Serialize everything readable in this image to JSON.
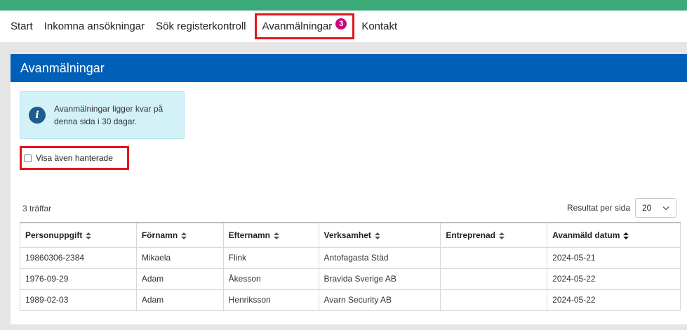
{
  "nav": {
    "items": [
      {
        "label": "Start"
      },
      {
        "label": "Inkomna ansökningar"
      },
      {
        "label": "Sök registerkontroll"
      },
      {
        "label": "Avanmälningar",
        "badge": "3"
      },
      {
        "label": "Kontakt"
      }
    ]
  },
  "panel": {
    "title": "Avanmälningar",
    "info_text": "Avanmälningar ligger kvar på denna sida i 30 dagar.",
    "checkbox_label": "Visa även hanterade",
    "hits": "3 träffar",
    "per_page_label": "Resultat per sida",
    "per_page_value": "20"
  },
  "table": {
    "headers": [
      "Personuppgift",
      "Förnamn",
      "Efternamn",
      "Verksamhet",
      "Entreprenad",
      "Avanmäld datum"
    ],
    "rows": [
      [
        "19860306-2384",
        "Mikaela",
        "Flink",
        "Antofagasta Städ",
        "",
        "2024-05-21"
      ],
      [
        "1976-09-29",
        "Adam",
        "Åkesson",
        "Bravida Sverige AB",
        "",
        "2024-05-22"
      ],
      [
        "1989-02-03",
        "Adam",
        "Henriksson",
        "Avarn Security AB",
        "",
        "2024-05-22"
      ]
    ]
  },
  "colors": {
    "topbar": "#3aaa78",
    "header": "#0060b7",
    "badge": "#c8087a",
    "highlight": "#e3161b",
    "info_bg": "#d3f2f8"
  }
}
